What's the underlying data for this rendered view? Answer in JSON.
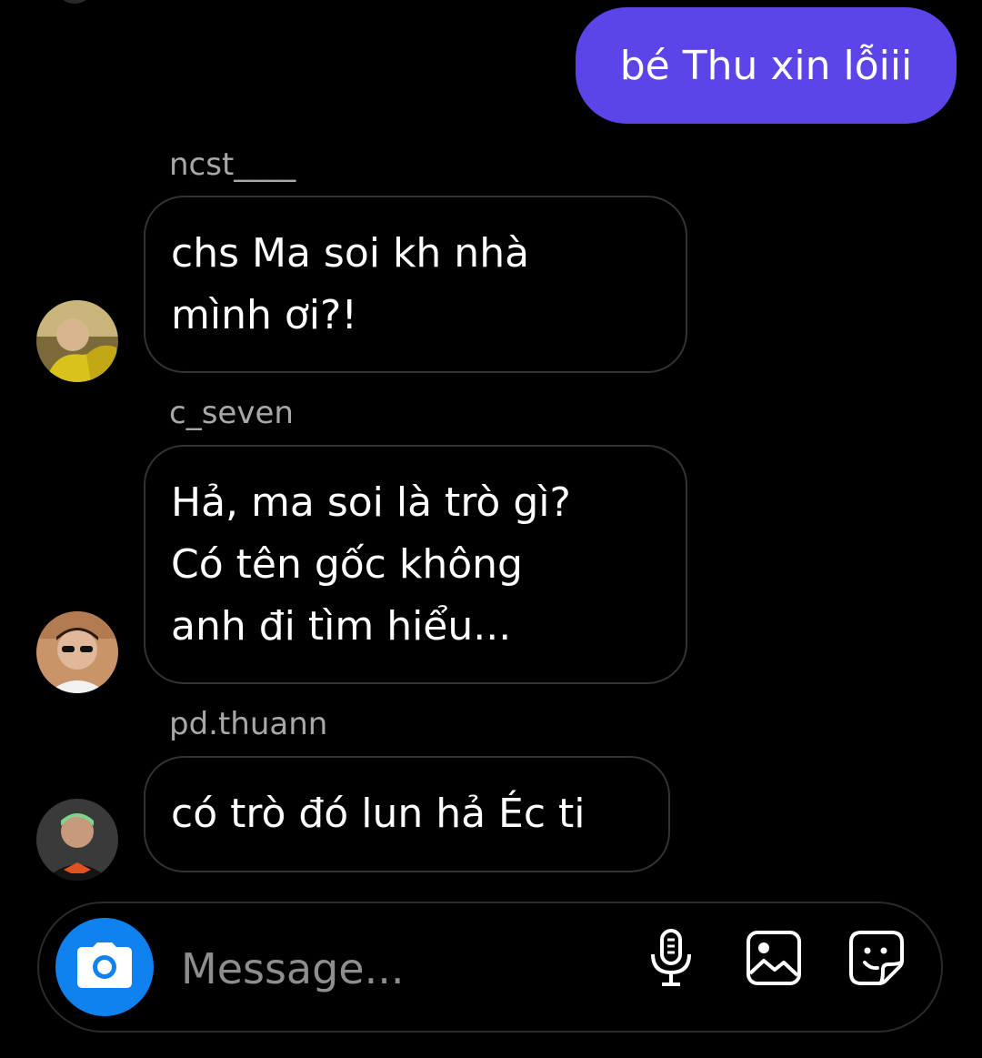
{
  "outgoing": {
    "text": "bé Thu xin lỗiii"
  },
  "messages": [
    {
      "sender": "ncst____",
      "lines": [
        "chs Ma soi kh nhà",
        "mình ơi?!"
      ],
      "avatar": "avatar-ncst"
    },
    {
      "sender": "c_seven",
      "lines": [
        "Hả, ma soi là trò gì?",
        "Có tên gốc không",
        "anh đi tìm hiểu..."
      ],
      "avatar": "avatar-c-seven"
    },
    {
      "sender": "pd.thuann",
      "lines": [
        "có trò đó lun hả Éc ti"
      ],
      "avatar": "avatar-pd-thuann"
    }
  ],
  "composer": {
    "placeholder": "Message...",
    "icons": [
      "camera-icon",
      "microphone-icon",
      "image-icon",
      "sticker-icon"
    ]
  },
  "colors": {
    "background": "#000000",
    "outgoing_bubble": "#5b45e8",
    "camera_button": "#0f82f0",
    "sender_name": "#a8a8a8",
    "bubble_border": "#333333"
  }
}
